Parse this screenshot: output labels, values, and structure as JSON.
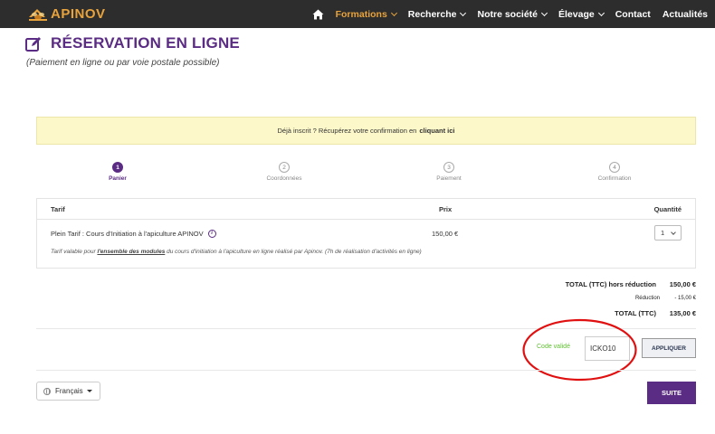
{
  "nav": {
    "logo_text": "APINOV",
    "items": [
      {
        "label": "Formations",
        "dropdown": true,
        "active": true
      },
      {
        "label": "Recherche",
        "dropdown": true
      },
      {
        "label": "Notre société",
        "dropdown": true
      },
      {
        "label": "Élevage",
        "dropdown": true
      },
      {
        "label": "Contact",
        "dropdown": false
      },
      {
        "label": "Actualités",
        "dropdown": false
      }
    ],
    "accent_color": "#e8a33c"
  },
  "header": {
    "title": "RÉSERVATION EN LIGNE",
    "subtitle": "(Paiement en ligne ou par voie postale possible)",
    "color": "#5b2c83"
  },
  "notice": {
    "text": "Déjà inscrit ? Récupérez votre confirmation en",
    "link": "cliquant ici"
  },
  "steps": [
    {
      "num": "1",
      "label": "Panier",
      "active": true
    },
    {
      "num": "2",
      "label": "Coordonnées",
      "active": false
    },
    {
      "num": "3",
      "label": "Paiement",
      "active": false
    },
    {
      "num": "4",
      "label": "Confirmation",
      "active": false
    }
  ],
  "table": {
    "col_tarif": "Tarif",
    "col_prix": "Prix",
    "col_quantite": "Quantité",
    "row": {
      "label": "Plein Tarif : Cours d'Initiation à l'apiculture APINOV",
      "info_icon": "i",
      "price": "150,00 €",
      "quantity": "1"
    },
    "note_prefix": "Tarif valable pour",
    "note_link": "l'ensemble des modules",
    "note_suffix": "du cours d'initiation à l'apiculture en ligne réalisé par Apinov. (7h de réalisation d'activités en ligne)"
  },
  "totals": {
    "before_label": "TOTAL (TTC) hors réduction",
    "before_value": "150,00 €",
    "reduction_label": "Réduction",
    "reduction_value": "- 15,00 €",
    "total_label": "TOTAL (TTC)",
    "total_value": "135,00 €"
  },
  "promo": {
    "status": "Code validé",
    "status_color": "#5fbf2f",
    "code": "ICKO10",
    "apply_label": "APPLIQUER",
    "highlight_color": "#e01010"
  },
  "footer": {
    "language": "Français",
    "next_label": "SUITE"
  }
}
